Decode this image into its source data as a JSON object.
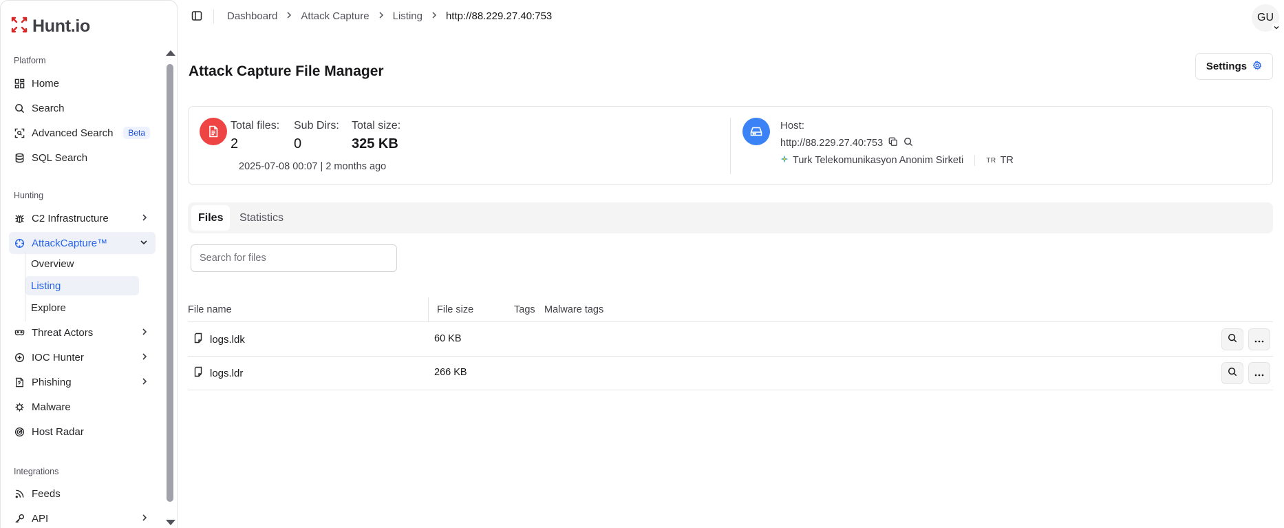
{
  "brand": {
    "name": "Hunt.io",
    "accent": "#2563eb",
    "logo_color": "#dc2626"
  },
  "sidebar": {
    "sections": [
      {
        "label": "Platform"
      },
      {
        "label": "Hunting"
      },
      {
        "label": "Integrations"
      }
    ],
    "platform_items": [
      {
        "label": "Home",
        "icon": "grid-icon"
      },
      {
        "label": "Search",
        "icon": "search-icon"
      },
      {
        "label": "Advanced Search",
        "icon": "scan-icon",
        "badge": "Beta"
      },
      {
        "label": "SQL Search",
        "icon": "database-icon"
      }
    ],
    "hunting_items": [
      {
        "label": "C2 Infrastructure",
        "icon": "bug-icon"
      },
      {
        "label": "AttackCapture™",
        "icon": "crosshair-icon"
      },
      {
        "label": "Threat Actors",
        "icon": "mask-icon"
      },
      {
        "label": "IOC Hunter",
        "icon": "plus-circle-icon"
      },
      {
        "label": "Phishing",
        "icon": "phishing-icon"
      },
      {
        "label": "Malware",
        "icon": "virus-icon"
      },
      {
        "label": "Host Radar",
        "icon": "radar-icon"
      }
    ],
    "attackcapture_sub": [
      {
        "label": "Overview"
      },
      {
        "label": "Listing"
      },
      {
        "label": "Explore"
      }
    ],
    "integration_items": [
      {
        "label": "Feeds",
        "icon": "rss-icon"
      },
      {
        "label": "API",
        "icon": "key-icon"
      }
    ]
  },
  "breadcrumb": [
    "Dashboard",
    "Attack Capture",
    "Listing",
    "http://88.229.27.40:753"
  ],
  "user": {
    "initials": "GU"
  },
  "page": {
    "title": "Attack Capture File Manager",
    "settings_label": "Settings"
  },
  "stats": {
    "total_files_label": "Total files:",
    "total_files": "2",
    "sub_dirs_label": "Sub Dirs:",
    "sub_dirs": "0",
    "total_size_label": "Total size:",
    "total_size": "325 KB",
    "timestamp": "2025-07-08 00:07",
    "relative_time": "2 months ago"
  },
  "host": {
    "label": "Host:",
    "url": "http://88.229.27.40:753",
    "org": "Turk Telekomunikasyon Anonim Sirketi",
    "country_code_small": "TR",
    "country": "TR"
  },
  "tabs": [
    "Files",
    "Statistics"
  ],
  "search": {
    "placeholder": "Search for files"
  },
  "table": {
    "columns": [
      "File name",
      "File size",
      "Tags",
      "Malware tags"
    ],
    "rows": [
      {
        "name": "logs.ldk",
        "size": "60 KB"
      },
      {
        "name": "logs.ldr",
        "size": "266 KB"
      }
    ]
  }
}
